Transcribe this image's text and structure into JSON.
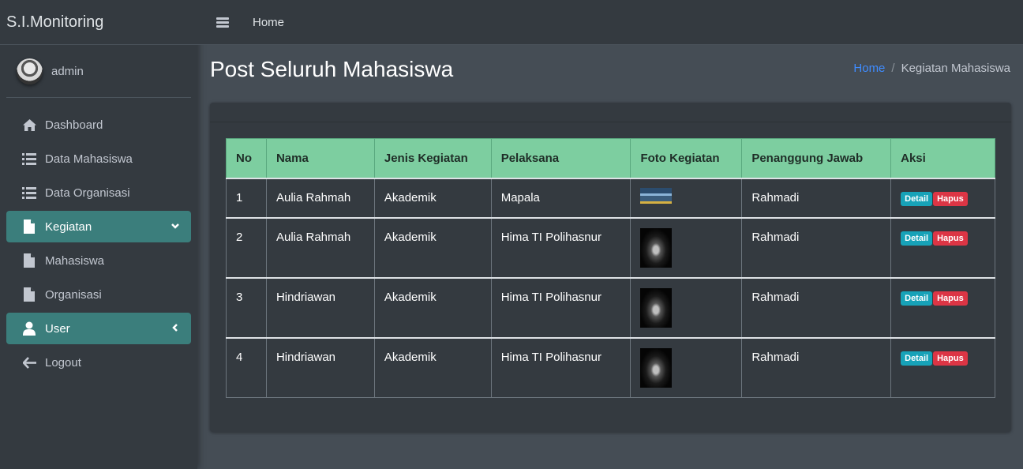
{
  "brand": "S.I.Monitoring",
  "user": {
    "name": "admin"
  },
  "sidebar": {
    "items": [
      {
        "label": "Dashboard",
        "icon": "home-icon"
      },
      {
        "label": "Data Mahasiswa",
        "icon": "list-icon"
      },
      {
        "label": "Data Organisasi",
        "icon": "list-icon"
      },
      {
        "label": "Kegiatan",
        "icon": "file-icon",
        "active": true,
        "arrow": "chevron-down-icon"
      },
      {
        "label": "Mahasiswa",
        "icon": "file-icon"
      },
      {
        "label": "Organisasi",
        "icon": "file-icon"
      },
      {
        "label": "User",
        "icon": "user-icon",
        "active": true,
        "arrow": "chevron-left-icon"
      },
      {
        "label": "Logout",
        "icon": "arrow-left-icon"
      }
    ]
  },
  "topbar": {
    "home": "Home"
  },
  "page": {
    "title": "Post Seluruh Mahasiswa"
  },
  "breadcrumb": {
    "home": "Home",
    "separator": "/",
    "current": "Kegiatan Mahasiswa"
  },
  "table": {
    "headers": [
      "No",
      "Nama",
      "Jenis Kegiatan",
      "Pelaksana",
      "Foto Kegiatan",
      "Penanggung Jawab",
      "Aksi"
    ],
    "rows": [
      {
        "no": "1",
        "nama": "Aulia Rahmah",
        "jenis": "Akademik",
        "pelaksana": "Mapala",
        "foto": "banner-thumbnail",
        "pj": "Rahmadi"
      },
      {
        "no": "2",
        "nama": "Aulia Rahmah",
        "jenis": "Akademik",
        "pelaksana": "Hima TI Polihasnur",
        "foto": "dark-thumbnail",
        "pj": "Rahmadi"
      },
      {
        "no": "3",
        "nama": "Hindriawan",
        "jenis": "Akademik",
        "pelaksana": "Hima TI Polihasnur",
        "foto": "dark-thumbnail",
        "pj": "Rahmadi"
      },
      {
        "no": "4",
        "nama": "Hindriawan",
        "jenis": "Akademik",
        "pelaksana": "Hima TI Polihasnur",
        "foto": "dark-thumbnail",
        "pj": "Rahmadi"
      }
    ],
    "actions": {
      "detail": "Detail",
      "hapus": "Hapus"
    }
  },
  "colors": {
    "accent": "#3b7e7c",
    "header": "#7dcea0",
    "info": "#17a2b8",
    "danger": "#dc3545",
    "link": "#3f8cff"
  }
}
